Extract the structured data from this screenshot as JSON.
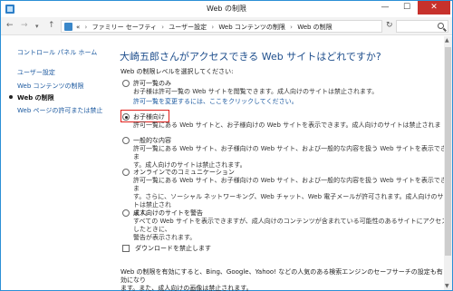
{
  "window": {
    "title": "Web の制限",
    "buttons": {
      "minimize": "—",
      "maximize": "☐",
      "close": "✕"
    }
  },
  "address": {
    "back_icon": "←",
    "forward_icon": "→",
    "dropdown_icon": "▾",
    "up_icon": "↑",
    "overflow": "«",
    "crumbs": [
      "ファミリー セーフティ",
      "ユーザー設定",
      "Web コンテンツの制限",
      "Web の制限"
    ],
    "separator": "›",
    "refresh_icon": "↻"
  },
  "sidebar": {
    "home": "コントロール パネル ホーム",
    "items": [
      {
        "label": "ユーザー設定",
        "active": false
      },
      {
        "label": "Web コンテンツの制限",
        "active": false
      },
      {
        "label": "Web の制限",
        "active": true
      },
      {
        "label": "Web ページの許可または禁止",
        "active": false
      }
    ]
  },
  "main": {
    "heading": "大崎五郎さんがアクセスできる Web サイトはどれですか?",
    "level_label": "Web の制限レベルを選択してください:",
    "options": [
      {
        "title": "許可一覧のみ",
        "desc": "お子様は許可一覧の Web サイトを閲覧できます。成人向けのサイトは禁止されます。",
        "link": "許可一覧を変更するには、ここをクリックしてください。",
        "selected": false
      },
      {
        "title": "お子様向け",
        "desc": "許可一覧にある Web サイトと、お子様向けの Web サイトを表示できます。成人向けのサイトは禁止されま",
        "selected": true
      },
      {
        "title": "一般的な内容",
        "desc": "許可一覧にある Web サイト、お子様向けの Web サイト、および一般的な内容を扱う Web サイトを表示できま\nす。成人向けのサイトは禁止されます。",
        "selected": false
      },
      {
        "title": "オンラインでのコミュニケーション",
        "desc": "許可一覧にある Web サイト、お子様向けの Web サイト、および一般的な内容を扱う Web サイトを表示できま\nす。さらに、ソーシャル ネットワーキング、Web チャット、Web 電子メールが許可されます。成人向けのサイトは禁止され\nます。",
        "selected": false
      },
      {
        "title": "成人向けのサイトを警告",
        "desc": "すべての Web サイトを表示できますが、成人向けのコンテンツが含まれている可能性のあるサイトにアクセスしたときに、\n警告が表示されます。",
        "selected": false
      }
    ],
    "download_label": "ダウンロードを禁止します",
    "download_checked": false,
    "note": "Web の制限を有効にすると、Bing、Google、Yahoo! などの人気のある検索エンジンのセーフサーチの設定も有効になり\nます。また、成人向けの画像は禁止されます。"
  },
  "colors": {
    "accent": "#1d5aa0",
    "heading": "#1e4e8c",
    "highlight": "#e0201c",
    "close": "#c7312c"
  }
}
